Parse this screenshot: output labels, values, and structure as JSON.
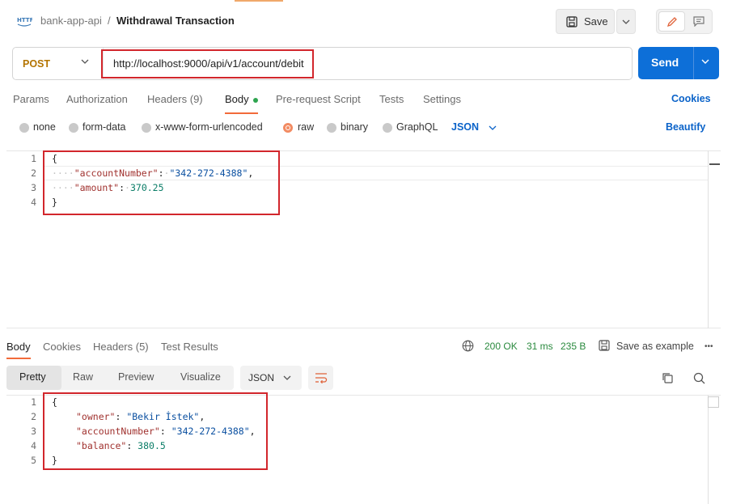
{
  "header": {
    "collection": "bank-app-api",
    "separator": "/",
    "request_name": "Withdrawal Transaction",
    "save_label": "Save"
  },
  "request": {
    "method": "POST",
    "url": "http://localhost:9000/api/v1/account/debit",
    "send_label": "Send"
  },
  "tabs": [
    {
      "label": "Params"
    },
    {
      "label": "Authorization"
    },
    {
      "label": "Headers (9)"
    },
    {
      "label": "Body"
    },
    {
      "label": "Pre-request Script"
    },
    {
      "label": "Tests"
    },
    {
      "label": "Settings"
    }
  ],
  "cookies_label": "Cookies",
  "body_types": [
    {
      "label": "none",
      "selected": false
    },
    {
      "label": "form-data",
      "selected": false
    },
    {
      "label": "x-www-form-urlencoded",
      "selected": false
    },
    {
      "label": "raw",
      "selected": true
    },
    {
      "label": "binary",
      "selected": false
    },
    {
      "label": "GraphQL",
      "selected": false
    }
  ],
  "raw_format": "JSON",
  "beautify_label": "Beautify",
  "request_body": {
    "line_numbers": [
      "1",
      "2",
      "3",
      "4"
    ],
    "open_brace": "{",
    "close_brace": "}",
    "line2_key": "\"accountNumber\"",
    "line2_value": "\"342-272-4388\"",
    "line3_key": "\"amount\"",
    "line3_value": "370.25"
  },
  "response": {
    "tabs": [
      {
        "label": "Body"
      },
      {
        "label": "Cookies"
      },
      {
        "label": "Headers (5)"
      },
      {
        "label": "Test Results"
      }
    ],
    "status": "200 OK",
    "time": "31 ms",
    "size": "235 B",
    "save_example_label": "Save as example",
    "more_label": "•••",
    "views": [
      "Pretty",
      "Raw",
      "Preview",
      "Visualize"
    ],
    "format": "JSON",
    "line_numbers": [
      "1",
      "2",
      "3",
      "4",
      "5"
    ],
    "open_brace": "{",
    "close_brace": "}",
    "owner_key": "\"owner\"",
    "owner_value": "\"Bekir İstek\"",
    "account_key": "\"accountNumber\"",
    "account_value": "\"342-272-4388\"",
    "balance_key": "\"balance\"",
    "balance_value": "380.5"
  },
  "colors": {
    "accent": "#f26b3a",
    "send_button": "#0d6fd8",
    "method": "#b37400",
    "status_ok": "#2a8a3e",
    "annotation_box": "#d2262c"
  }
}
